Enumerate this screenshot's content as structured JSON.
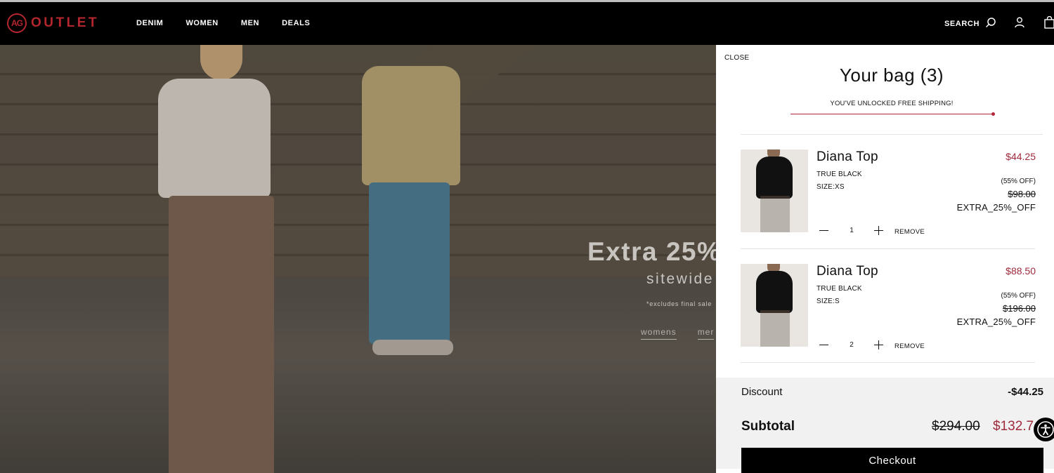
{
  "header": {
    "logo_badge": "AG",
    "logo_text": "OUTLET",
    "nav": [
      "DENIM",
      "WOMEN",
      "MEN",
      "DEALS"
    ],
    "search_label": "SEARCH"
  },
  "hero": {
    "headline": "Extra 25%",
    "subheadline": "sitewide",
    "note": "*excludes final sale",
    "links": [
      "womens",
      "mer"
    ]
  },
  "bag": {
    "close_label": "CLOSE",
    "title": "Your bag (3)",
    "shipping_message": "YOU'VE UNLOCKED FREE SHIPPING!",
    "shipping_progress": 1.0,
    "items": [
      {
        "name": "Diana Top",
        "color": "TRUE BLACK",
        "size": "SIZE:XS",
        "price": "$44.25",
        "discount_pct": "(55% OFF)",
        "original_price": "$98.00",
        "promo": "EXTRA_25%_OFF",
        "quantity": "1",
        "remove_label": "REMOVE"
      },
      {
        "name": "Diana Top",
        "color": "TRUE BLACK",
        "size": "SIZE:S",
        "price": "$88.50",
        "discount_pct": "(55% OFF)",
        "original_price": "$196.00",
        "promo": "EXTRA_25%_OFF",
        "quantity": "2",
        "remove_label": "REMOVE"
      }
    ],
    "discount_label": "Discount",
    "discount_value": "-$44.25",
    "subtotal_label": "Subtotal",
    "subtotal_original": "$294.00",
    "subtotal_value": "$132.7",
    "checkout_label": "Checkout"
  },
  "colors": {
    "brand_red": "#b3262e",
    "sale_price": "#9e2a3c",
    "progress": "#b3263a",
    "header_bg": "#000000"
  }
}
